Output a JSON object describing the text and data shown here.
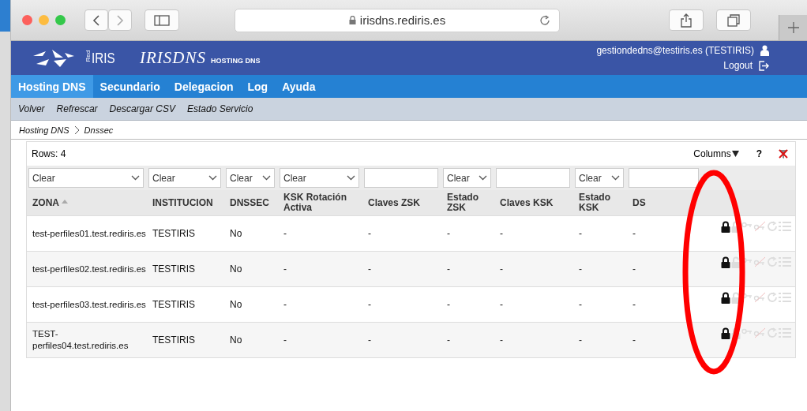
{
  "browser": {
    "url": "irisdns.rediris.es"
  },
  "header": {
    "logo_small": "Red",
    "logo_text": "IRIS",
    "app_name": "IRISDNS",
    "app_subtitle": "HOSTING DNS",
    "user": "gestiondedns@testiris.es (TESTIRIS)",
    "logout": "Logout"
  },
  "nav": [
    {
      "label": "Hosting DNS",
      "selected": true
    },
    {
      "label": "Secundario",
      "selected": false
    },
    {
      "label": "Delegacion",
      "selected": false
    },
    {
      "label": "Log",
      "selected": false
    },
    {
      "label": "Ayuda",
      "selected": false
    }
  ],
  "toolbar": [
    "Volver",
    "Refrescar",
    "Descargar CSV",
    "Estado Servicio"
  ],
  "breadcrumb": [
    "Hosting DNS",
    "Dnssec"
  ],
  "table": {
    "rows_count": "Rows: 4",
    "columns_button": "Columns",
    "help": "?",
    "filters": [
      {
        "kind": "select",
        "value": "Clear"
      },
      {
        "kind": "select",
        "value": "Clear"
      },
      {
        "kind": "select",
        "value": "Clear"
      },
      {
        "kind": "select",
        "value": "Clear"
      },
      {
        "kind": "input"
      },
      {
        "kind": "select",
        "value": "Clear"
      },
      {
        "kind": "input"
      },
      {
        "kind": "select",
        "value": "Clear"
      },
      {
        "kind": "input"
      }
    ],
    "columns": [
      "ZONA",
      "INSTITUCION",
      "DNSSEC",
      "KSK Rotación Activa",
      "Claves ZSK",
      "Estado ZSK",
      "Claves KSK",
      "Estado KSK",
      "DS"
    ],
    "rows": [
      [
        "test-perfiles01.test.rediris.es",
        "TESTIRIS",
        "No",
        "-",
        "-",
        "-",
        "-",
        "-",
        "-"
      ],
      [
        "test-perfiles02.test.rediris.es",
        "TESTIRIS",
        "No",
        "-",
        "-",
        "-",
        "-",
        "-",
        "-"
      ],
      [
        "test-perfiles03.test.rediris.es",
        "TESTIRIS",
        "No",
        "-",
        "-",
        "-",
        "-",
        "-",
        "-"
      ],
      [
        "TEST-perfiles04.test.rediris.es",
        "TESTIRIS",
        "No",
        "-",
        "-",
        "-",
        "-",
        "-",
        "-"
      ]
    ]
  }
}
